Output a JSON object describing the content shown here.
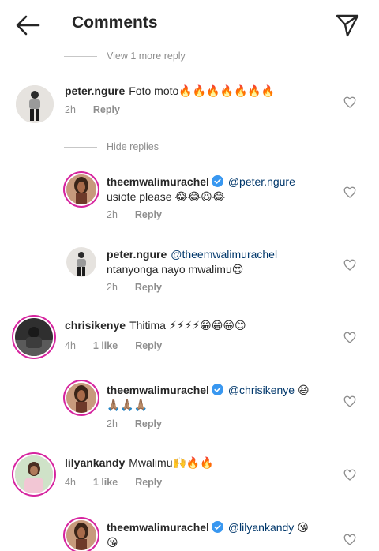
{
  "header": {
    "title": "Comments"
  },
  "toggles": {
    "view_more": "View 1 more reply",
    "hide": "Hide replies"
  },
  "comments": [
    {
      "username": "peter.ngure",
      "text": "Foto moto🔥🔥🔥🔥🔥🔥🔥",
      "time": "2h",
      "reply": "Reply"
    },
    {
      "username": "theemwalimurachel",
      "mention": "@peter.ngure",
      "text": "usiote please 😂😂😆😂",
      "time": "2h",
      "reply": "Reply"
    },
    {
      "username": "peter.ngure",
      "mention": "@theemwalimurachel",
      "text": "ntanyonga nayo mwalimu😍",
      "time": "2h",
      "reply": "Reply"
    },
    {
      "username": "chrisikenye",
      "text": "Thitima ⚡⚡⚡⚡😁😁😁😊",
      "time": "4h",
      "likes": "1 like",
      "reply": "Reply"
    },
    {
      "username": "theemwalimurachel",
      "mention": "@chrisikenye",
      "text": "😆",
      "text2": "🙏🏽🙏🏽🙏🏽",
      "time": "2h",
      "reply": "Reply"
    },
    {
      "username": "lilyankandy",
      "text": "Mwalimu🙌🔥🔥",
      "time": "4h",
      "likes": "1 like",
      "reply": "Reply"
    },
    {
      "username": "theemwalimurachel",
      "mention": "@lilyankandy",
      "text": "😘",
      "text2": "😘"
    }
  ],
  "icons": {
    "back": "arrow-left-icon",
    "send": "paper-plane-icon",
    "like": "heart-outline-icon",
    "verified": "verified-badge-icon"
  },
  "colors": {
    "mention": "#00376b",
    "muted": "#8e8e8e",
    "verified": "#3897f0",
    "story_ring": "#d6249f"
  }
}
